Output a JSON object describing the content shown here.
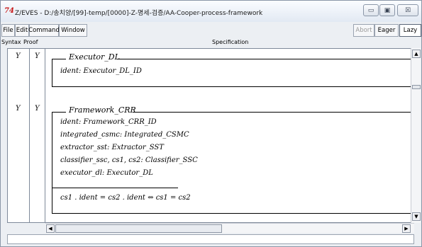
{
  "window": {
    "app_icon": "74",
    "title": "Z/EVES - D:/송치양/[99]-temp/[0000]-Z-명세-검증/AA-Cooper-process-framework",
    "minimize_glyph": "▭",
    "maximize_glyph": "▣",
    "close_glyph": "☒"
  },
  "toolbar": {
    "menus": [
      "File",
      "Edit",
      "Command",
      "Window"
    ],
    "abort_label": "Abort",
    "eager_label": "Eager",
    "lazy_label": "Lazy"
  },
  "columns": {
    "syntax": "Syntax",
    "proof": "Proof",
    "specification": "Specification"
  },
  "schemas": [
    {
      "syntax_mark": "Y",
      "proof_mark": "Y",
      "name": "Executor_DL",
      "declarations": [
        "ident: Executor_DL_ID"
      ],
      "predicate": ""
    },
    {
      "syntax_mark": "Y",
      "proof_mark": "Y",
      "name": "Framework_CRR",
      "declarations": [
        "ident: Framework_CRR_ID",
        "integrated_csmc: Integrated_CSMC",
        "extractor_sst: Extractor_SST",
        "classifier_ssc, cs1, cs2: Classifier_SSC",
        "executor_dl: Executor_DL"
      ],
      "predicate": "cs1 . ident = cs2 . ident ⇔ cs1 = cs2"
    }
  ],
  "scroll": {
    "up_glyph": "▲",
    "down_glyph": "▼",
    "left_glyph": "◀",
    "right_glyph": "▶"
  }
}
